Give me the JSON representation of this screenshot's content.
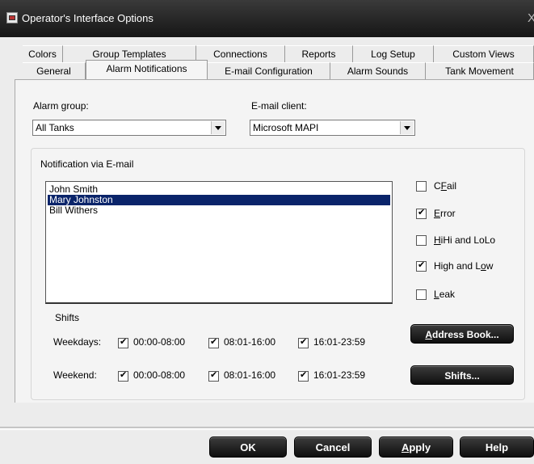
{
  "window": {
    "title": "Operator's Interface Options",
    "close": "X"
  },
  "tabs": {
    "row1": [
      "Colors",
      "Group Templates",
      "Connections",
      "Reports",
      "Log Setup",
      "Custom Views"
    ],
    "row2": [
      "General",
      "Alarm Notifications",
      "E-mail Configuration",
      "Alarm Sounds",
      "Tank Movement"
    ],
    "selected": "Alarm Notifications"
  },
  "alarm_group": {
    "label": "Alarm group:",
    "value": "All Tanks"
  },
  "email_client": {
    "label": "E-mail client:",
    "value": "Microsoft MAPI"
  },
  "notification": {
    "group_label": "Notification via E-mail",
    "recipients": [
      "John Smith",
      "Mary Johnston",
      "Bill Withers"
    ],
    "selected_recipient": "Mary Johnston"
  },
  "alarm_types": [
    {
      "pre": "C",
      "u": "F",
      "post": "ail",
      "checked": false
    },
    {
      "pre": "",
      "u": "E",
      "post": "rror",
      "checked": true
    },
    {
      "pre": "",
      "u": "H",
      "post": "iHi and LoLo",
      "checked": false
    },
    {
      "pre": "High and L",
      "u": "o",
      "post": "w",
      "checked": true
    },
    {
      "pre": "",
      "u": "L",
      "post": "eak",
      "checked": false
    }
  ],
  "shifts": {
    "label": "Shifts",
    "weekdays_label": "Weekdays:",
    "weekend_label": "Weekend:",
    "ranges": [
      "00:00-08:00",
      "08:01-16:00",
      "16:01-23:59"
    ],
    "weekdays_checked": [
      true,
      true,
      true
    ],
    "weekend_checked": [
      true,
      true,
      true
    ]
  },
  "side_buttons": {
    "address_book": {
      "u": "A",
      "rest": "ddress Book..."
    },
    "shifts": "Shifts..."
  },
  "footer": {
    "ok": "OK",
    "cancel": "Cancel",
    "apply": {
      "u": "A",
      "rest": "pply"
    },
    "help": "Help"
  }
}
